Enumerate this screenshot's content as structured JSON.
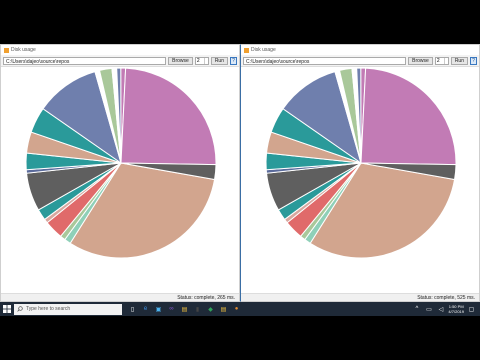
{
  "windows": [
    {
      "id": "left",
      "title": "Disk usage",
      "path": "C:\\Users\\dajeo\\source\\repos",
      "browse_label": "Browse",
      "depth": "2",
      "run_label": "Run",
      "help_label": "?",
      "status": "Status: complete, 265 ms."
    },
    {
      "id": "right",
      "title": "Disk usage",
      "path": "C:\\Users\\dajeo\\source\\repos",
      "browse_label": "Browse",
      "depth": "2",
      "run_label": "Run",
      "help_label": "?",
      "status": "Status: complete, 525 ms."
    }
  ],
  "chart_data": [
    {
      "type": "pie",
      "slices": [
        {
          "value": 31.2,
          "color": "#d2a58e"
        },
        {
          "value": 1.1,
          "color": "#8fd0b8"
        },
        {
          "value": 0.9,
          "color": "#a9c89a"
        },
        {
          "value": 3.2,
          "color": "#e06a6a"
        },
        {
          "value": 0.7,
          "color": "#d7a8a0"
        },
        {
          "value": 1.9,
          "color": "#2a9a9a"
        },
        {
          "value": 6.5,
          "color": "#5f5f5f"
        },
        {
          "value": 0.6,
          "color": "#5b6b9b"
        },
        {
          "value": 2.8,
          "color": "#2a9a9a"
        },
        {
          "value": 3.6,
          "color": "#d2a58e"
        },
        {
          "value": 4.4,
          "color": "#2a9a9a"
        },
        {
          "value": 10.9,
          "color": "#6f7fad"
        },
        {
          "value": 0.8,
          "color": "#fff"
        },
        {
          "value": 2.1,
          "color": "#a9c89a"
        },
        {
          "value": 0.8,
          "color": "#fff"
        },
        {
          "value": 0.7,
          "color": "#6f7fad"
        },
        {
          "value": 0.8,
          "color": "#c27bb5"
        },
        {
          "value": 24.5,
          "color": "#c27bb5"
        },
        {
          "value": 2.5,
          "color": "#5f5f5f"
        }
      ]
    },
    {
      "type": "pie",
      "slices": [
        {
          "value": 31.2,
          "color": "#d2a58e"
        },
        {
          "value": 1.1,
          "color": "#8fd0b8"
        },
        {
          "value": 0.9,
          "color": "#a9c89a"
        },
        {
          "value": 3.2,
          "color": "#e06a6a"
        },
        {
          "value": 0.7,
          "color": "#d7a8a0"
        },
        {
          "value": 1.9,
          "color": "#2a9a9a"
        },
        {
          "value": 6.5,
          "color": "#5f5f5f"
        },
        {
          "value": 0.6,
          "color": "#5b6b9b"
        },
        {
          "value": 2.8,
          "color": "#2a9a9a"
        },
        {
          "value": 3.6,
          "color": "#d2a58e"
        },
        {
          "value": 4.4,
          "color": "#2a9a9a"
        },
        {
          "value": 10.9,
          "color": "#6f7fad"
        },
        {
          "value": 0.8,
          "color": "#fff"
        },
        {
          "value": 2.1,
          "color": "#a9c89a"
        },
        {
          "value": 0.8,
          "color": "#fff"
        },
        {
          "value": 0.7,
          "color": "#6f7fad"
        },
        {
          "value": 0.8,
          "color": "#c27bb5"
        },
        {
          "value": 24.5,
          "color": "#c27bb5"
        },
        {
          "value": 2.5,
          "color": "#5f5f5f"
        }
      ]
    }
  ],
  "taskbar": {
    "search_placeholder": "Type here to search",
    "icons": [
      "task-view-icon",
      "edge-icon",
      "store-icon",
      "visual-studio-icon",
      "file-explorer-icon",
      "terminal-icon",
      "app-icon",
      "folder-icon",
      "disk-usage-icon"
    ],
    "time": "1:50 PM",
    "date": "4/7/2019"
  }
}
